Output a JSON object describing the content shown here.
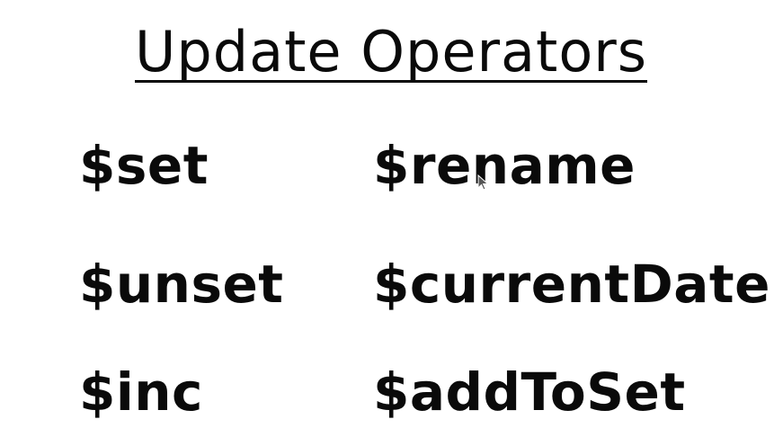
{
  "title": "Update Operators",
  "operators": {
    "col1": [
      "$set",
      "$unset",
      "$inc"
    ],
    "col2": [
      "$rename",
      "$currentDate",
      "$addToSet"
    ]
  },
  "colors": {
    "background": "#ffffff",
    "text": "#0a0a0a"
  },
  "icons": {
    "cursor": "mouse-pointer-icon"
  }
}
